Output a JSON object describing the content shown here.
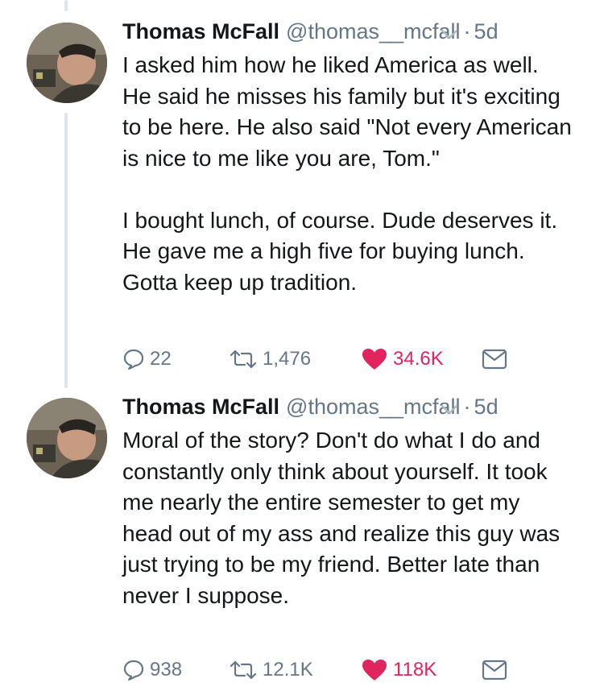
{
  "tweets": [
    {
      "name": "Thomas McFall",
      "handle": "@thomas__mcfall",
      "separator": "·",
      "time": "5d",
      "paragraphs": [
        "I asked him how he liked America as well. He said he misses his family but it's exciting to be here. He also said \"Not every American is nice to me like you are, Tom.\"",
        "I bought lunch, of course. Dude deserves it. He gave me a high five for buying lunch. Gotta keep up tradition."
      ],
      "replies": "22",
      "retweets": "1,476",
      "likes": "34.6K",
      "liked": true
    },
    {
      "name": "Thomas McFall",
      "handle": "@thomas__mcfall",
      "separator": "·",
      "time": "5d",
      "paragraphs": [
        "Moral of the story? Don't do what I do and constantly only think about yourself. It took me nearly the entire semester to get my head out of my ass and realize this guy was just trying to be my friend. Better late than never I suppose."
      ],
      "replies": "938",
      "retweets": "12.1K",
      "likes": "118K",
      "liked": true
    }
  ],
  "icons": {
    "reply": "reply-icon",
    "retweet": "retweet-icon",
    "like": "heart-icon",
    "dm": "envelope-icon",
    "menu": "chevron-down-icon"
  },
  "colors": {
    "text": "#14171a",
    "secondary": "#657786",
    "like": "#e0245e",
    "thread_line": "#dfe4e8"
  }
}
